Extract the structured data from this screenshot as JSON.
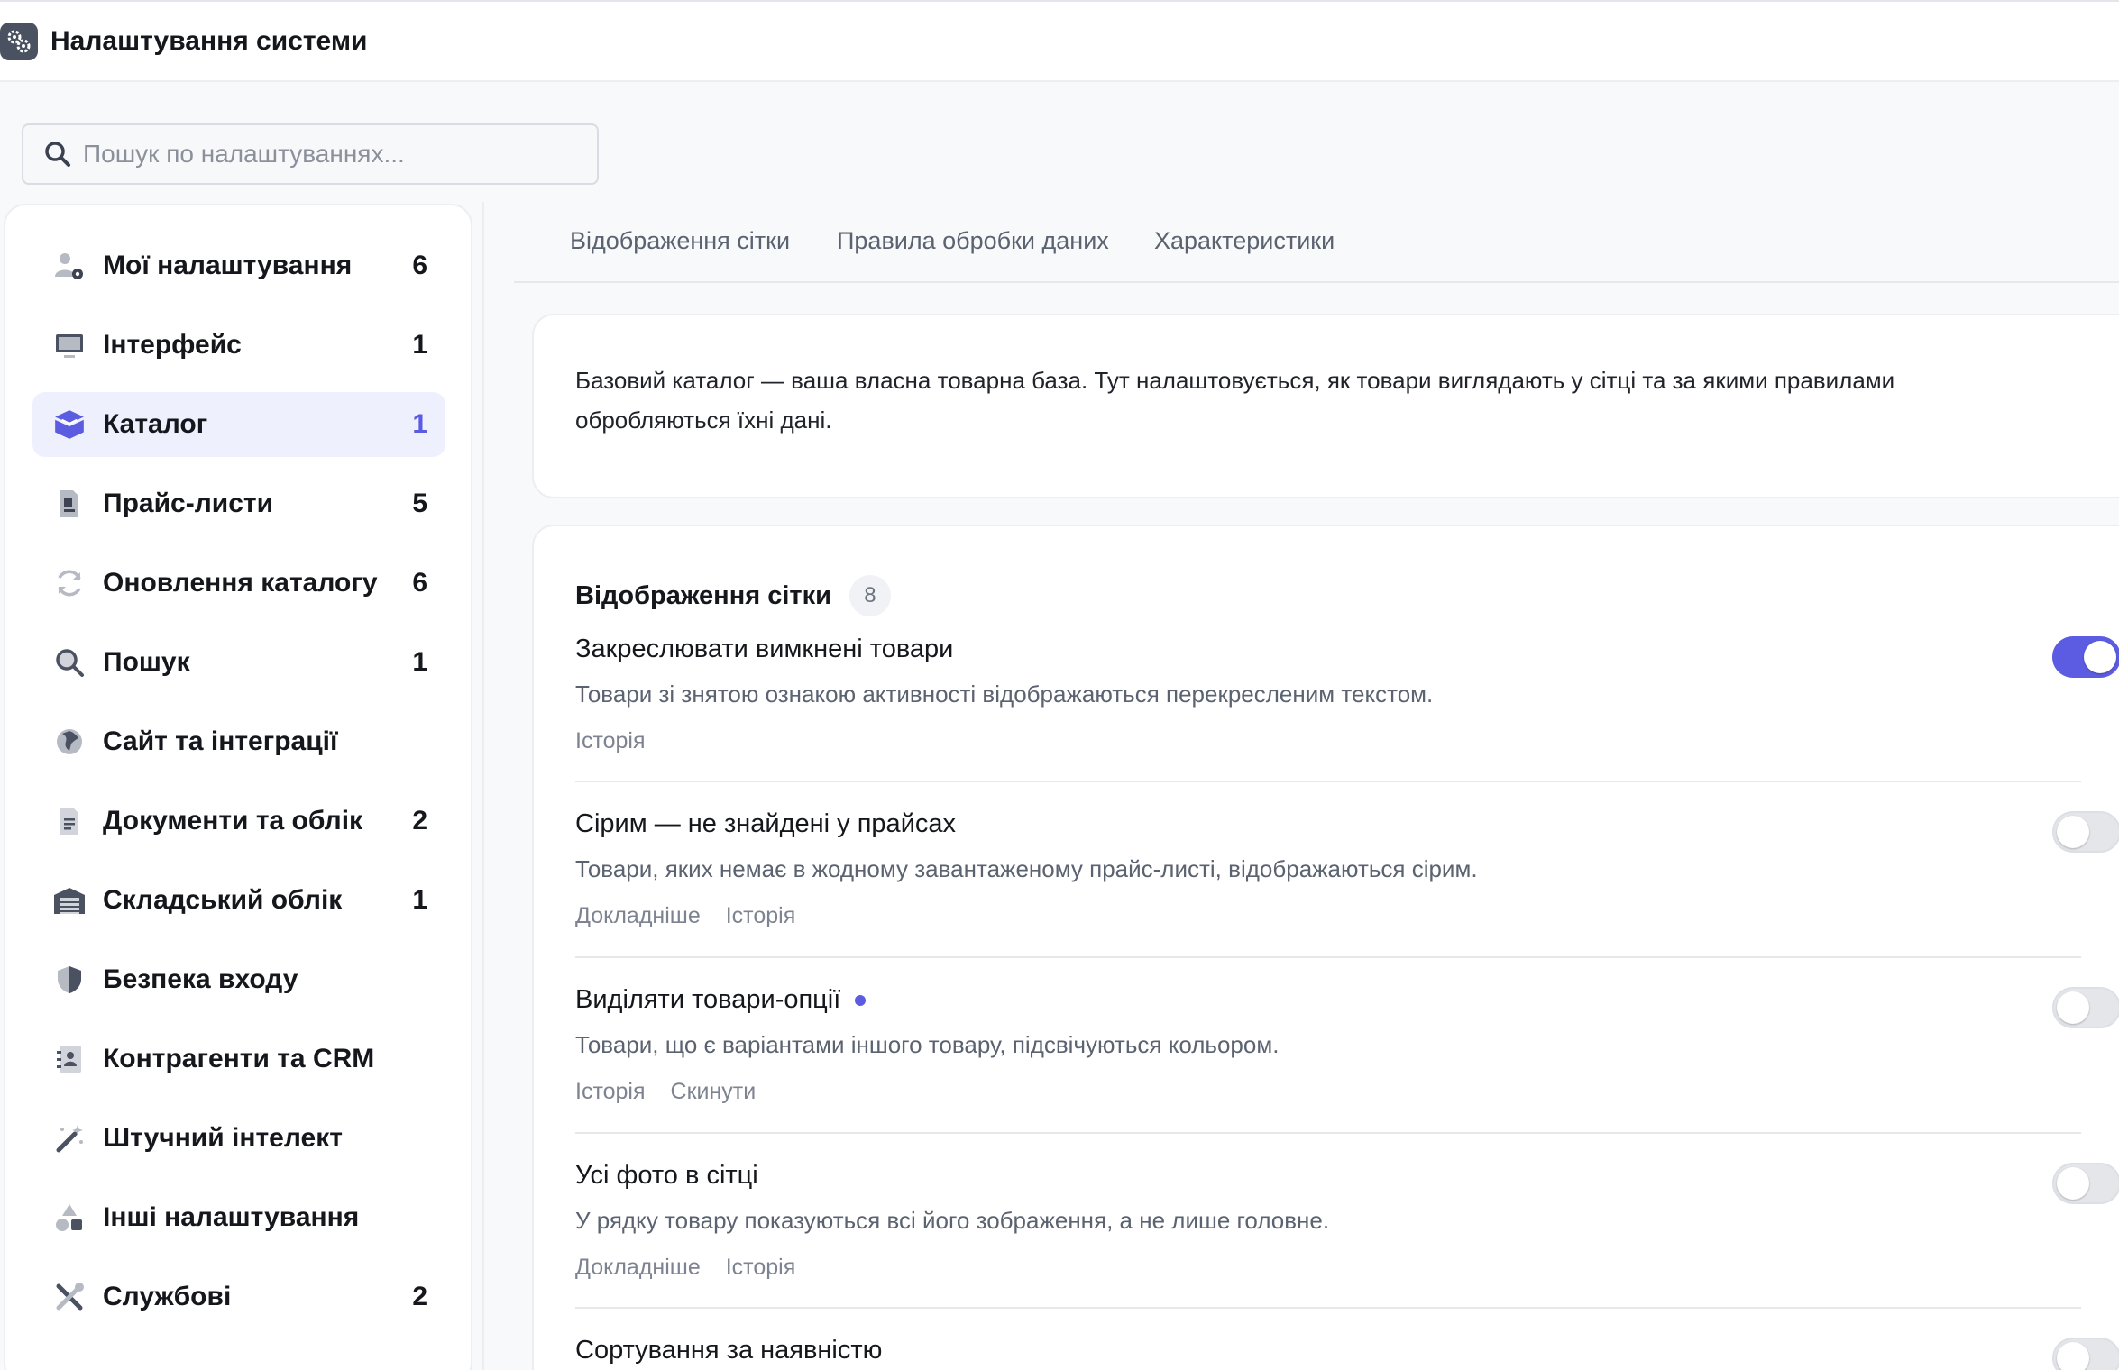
{
  "header": {
    "title": "Налаштування системи",
    "icon": "gears-icon"
  },
  "search": {
    "placeholder": "Пошук по налаштуваннях..."
  },
  "sidebar": {
    "items": [
      {
        "label": "Мої налаштування",
        "count": "6",
        "icon": "user-gear-icon",
        "active": false
      },
      {
        "label": "Інтерфейс",
        "count": "1",
        "icon": "monitor-icon",
        "active": false
      },
      {
        "label": "Каталог",
        "count": "1",
        "icon": "box-icon",
        "active": true
      },
      {
        "label": "Прайс-листи",
        "count": "5",
        "icon": "price-doc-icon",
        "active": false
      },
      {
        "label": "Оновлення каталогу",
        "count": "6",
        "icon": "refresh-icon",
        "active": false
      },
      {
        "label": "Пошук",
        "count": "1",
        "icon": "search-icon",
        "active": false
      },
      {
        "label": "Сайт та інтеграції",
        "count": "",
        "icon": "globe-icon",
        "active": false
      },
      {
        "label": "Документи та облік",
        "count": "2",
        "icon": "document-icon",
        "active": false
      },
      {
        "label": "Складський облік",
        "count": "1",
        "icon": "warehouse-icon",
        "active": false
      },
      {
        "label": "Безпека входу",
        "count": "",
        "icon": "shield-icon",
        "active": false
      },
      {
        "label": "Контрагенти та CRM",
        "count": "",
        "icon": "contact-card-icon",
        "active": false
      },
      {
        "label": "Штучний інтелект",
        "count": "",
        "icon": "magic-wand-icon",
        "active": false
      },
      {
        "label": "Інші налаштування",
        "count": "",
        "icon": "shapes-icon",
        "active": false
      },
      {
        "label": "Службові",
        "count": "2",
        "icon": "tools-icon",
        "active": false
      }
    ]
  },
  "tabs": [
    {
      "label": "Відображення сітки"
    },
    {
      "label": "Правила обробки даних"
    },
    {
      "label": "Характеристики"
    }
  ],
  "intro": {
    "text": "Базовий каталог — ваша власна товарна база. Тут налаштовується, як товари виглядають у сітці та за якими правилами обробляються їхні дані."
  },
  "section": {
    "title": "Відображення сітки",
    "count": "8",
    "settings": [
      {
        "title": "Закреслювати вимкнені товари",
        "description": "Товари зі знятою ознакою активності відображаються перекресленим текстом.",
        "links": [
          "Історія"
        ],
        "enabled": true,
        "modified": false
      },
      {
        "title": "Сірим — не знайдені у прайсах",
        "description": "Товари, яких немає в жодному завантаженому прайс-листі, відображаються сірим.",
        "links": [
          "Докладніше",
          "Історія"
        ],
        "enabled": false,
        "modified": false
      },
      {
        "title": "Виділяти товари-опції",
        "description": "Товари, що є варіантами іншого товару, підсвічуються кольором.",
        "links": [
          "Історія",
          "Скинути"
        ],
        "enabled": false,
        "modified": true
      },
      {
        "title": "Усі фото в сітці",
        "description": "У рядку товару показуються всі його зображення, а не лише головне.",
        "links": [
          "Докладніше",
          "Історія"
        ],
        "enabled": false,
        "modified": false
      },
      {
        "title": "Сортування за наявністю",
        "description": "",
        "links": [],
        "enabled": false,
        "modified": false
      }
    ]
  },
  "colors": {
    "accent": "#5b5ce2",
    "active_bg": "#eef0fd",
    "text": "#15171c",
    "muted": "#5b6270"
  }
}
